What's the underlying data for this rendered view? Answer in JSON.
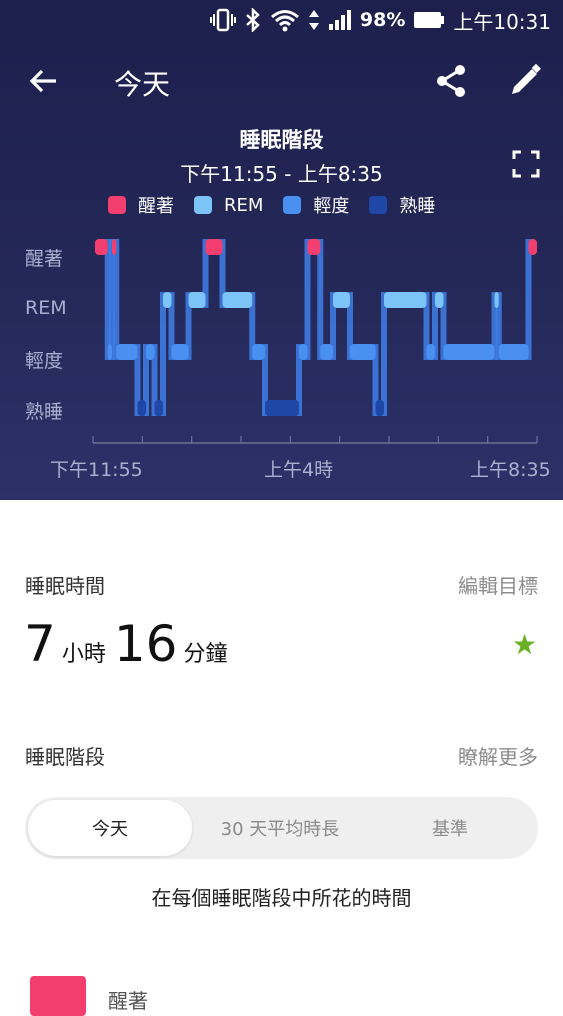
{
  "status_bar": {
    "battery": "98%",
    "time": "上午10:31"
  },
  "toolbar": {
    "title": "今天"
  },
  "chart": {
    "title": "睡眠階段",
    "subtitle": "下午11:55 - 上午8:35",
    "legend": [
      {
        "label": "醒著",
        "color": "#f23f6f"
      },
      {
        "label": "REM",
        "color": "#7cc3f7"
      },
      {
        "label": "輕度",
        "color": "#4a90f0"
      },
      {
        "label": "熟睡",
        "color": "#1f47a6"
      }
    ],
    "y_labels": [
      "醒著",
      "REM",
      "輕度",
      "熟睡"
    ],
    "x_labels": [
      "下午11:55",
      "上午4時",
      "上午8:35"
    ]
  },
  "chart_data": {
    "type": "line",
    "title": "睡眠階段",
    "categories": [
      "醒著",
      "REM",
      "輕度",
      "熟睡"
    ],
    "x_range": [
      "下午11:55",
      "上午8:35"
    ],
    "x_unit": "minutes since 23:55",
    "segments": [
      {
        "start": 0,
        "end": 15,
        "stage": "醒著"
      },
      {
        "start": 15,
        "end": 20,
        "stage": "輕度"
      },
      {
        "start": 20,
        "end": 25,
        "stage": "醒著"
      },
      {
        "start": 25,
        "end": 50,
        "stage": "輕度"
      },
      {
        "start": 50,
        "end": 60,
        "stage": "熟睡"
      },
      {
        "start": 60,
        "end": 70,
        "stage": "輕度"
      },
      {
        "start": 70,
        "end": 80,
        "stage": "熟睡"
      },
      {
        "start": 80,
        "end": 90,
        "stage": "REM"
      },
      {
        "start": 90,
        "end": 110,
        "stage": "輕度"
      },
      {
        "start": 110,
        "end": 130,
        "stage": "REM"
      },
      {
        "start": 130,
        "end": 150,
        "stage": "醒著"
      },
      {
        "start": 150,
        "end": 185,
        "stage": "REM"
      },
      {
        "start": 185,
        "end": 200,
        "stage": "輕度"
      },
      {
        "start": 200,
        "end": 240,
        "stage": "熟睡"
      },
      {
        "start": 240,
        "end": 250,
        "stage": "輕度"
      },
      {
        "start": 250,
        "end": 265,
        "stage": "醒著"
      },
      {
        "start": 265,
        "end": 280,
        "stage": "輕度"
      },
      {
        "start": 280,
        "end": 300,
        "stage": "REM"
      },
      {
        "start": 300,
        "end": 330,
        "stage": "輕度"
      },
      {
        "start": 330,
        "end": 340,
        "stage": "熟睡"
      },
      {
        "start": 340,
        "end": 390,
        "stage": "REM"
      },
      {
        "start": 390,
        "end": 400,
        "stage": "輕度"
      },
      {
        "start": 400,
        "end": 410,
        "stage": "REM"
      },
      {
        "start": 410,
        "end": 470,
        "stage": "輕度"
      },
      {
        "start": 470,
        "end": 475,
        "stage": "REM"
      },
      {
        "start": 475,
        "end": 510,
        "stage": "輕度"
      },
      {
        "start": 510,
        "end": 520,
        "stage": "醒著"
      }
    ]
  },
  "summary": {
    "sleep_time_label": "睡眠時間",
    "edit_goal": "編輯目標",
    "hours": "7",
    "hours_unit": "小時",
    "minutes": "16",
    "minutes_unit": "分鐘",
    "stages_label": "睡眠階段",
    "learn_more": "瞭解更多"
  },
  "tabs": [
    {
      "label": "今天",
      "active": true
    },
    {
      "label": "30 天平均時長",
      "active": false
    },
    {
      "label": "基準",
      "active": false
    }
  ],
  "caption": "在每個睡眠階段中所花的時間",
  "stage_list": [
    {
      "label": "醒著",
      "color": "#f23f6f"
    }
  ]
}
